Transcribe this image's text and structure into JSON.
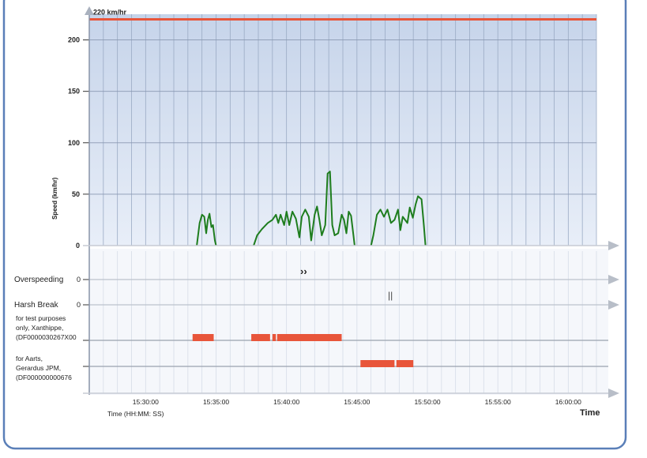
{
  "chart_data": [
    {
      "type": "line",
      "ylabel": "Speed (km/hr)",
      "y_ticks": [
        0,
        50,
        100,
        150,
        200
      ],
      "ylim": [
        0,
        225
      ],
      "xlim": [
        "15:26:00",
        "15:62:00"
      ],
      "grid": true,
      "threshold": {
        "value": 220,
        "label": "220 km/hr",
        "color": "#e8553a"
      },
      "series": [
        {
          "color": "#1e7d1e",
          "segments": [
            [
              [
                "15:33:38",
                0
              ],
              [
                "15:33:50",
                22
              ],
              [
                "15:34:00",
                30
              ],
              [
                "15:34:10",
                28
              ],
              [
                "15:34:18",
                12
              ],
              [
                "15:34:25",
                25
              ],
              [
                "15:34:32",
                31
              ],
              [
                "15:34:40",
                18
              ],
              [
                "15:34:47",
                20
              ],
              [
                "15:34:55",
                5
              ],
              [
                "15:35:00",
                0
              ]
            ],
            [
              [
                "15:37:40",
                0
              ],
              [
                "15:37:55",
                10
              ],
              [
                "15:38:15",
                16
              ],
              [
                "15:38:40",
                22
              ],
              [
                "15:39:00",
                25
              ],
              [
                "15:39:15",
                30
              ],
              [
                "15:39:25",
                22
              ],
              [
                "15:39:35",
                30
              ],
              [
                "15:39:50",
                20
              ],
              [
                "15:40:00",
                33
              ],
              [
                "15:40:12",
                20
              ],
              [
                "15:40:25",
                33
              ],
              [
                "15:40:40",
                26
              ],
              [
                "15:40:55",
                8
              ],
              [
                "15:41:05",
                28
              ],
              [
                "15:41:20",
                35
              ],
              [
                "15:41:35",
                28
              ],
              [
                "15:41:45",
                5
              ],
              [
                "15:42:00",
                30
              ],
              [
                "15:42:10",
                38
              ],
              [
                "15:42:20",
                25
              ],
              [
                "15:42:30",
                10
              ],
              [
                "15:42:38",
                15
              ],
              [
                "15:42:45",
                20
              ],
              [
                "15:42:55",
                70
              ],
              [
                "15:43:05",
                72
              ],
              [
                "15:43:15",
                20
              ],
              [
                "15:43:25",
                10
              ],
              [
                "15:43:40",
                12
              ],
              [
                "15:43:55",
                30
              ],
              [
                "15:44:05",
                25
              ],
              [
                "15:44:15",
                12
              ],
              [
                "15:44:25",
                33
              ],
              [
                "15:44:35",
                29
              ],
              [
                "15:44:45",
                10
              ],
              [
                "15:44:50",
                0
              ]
            ],
            [
              [
                "15:46:00",
                0
              ],
              [
                "15:46:10",
                10
              ],
              [
                "15:46:25",
                30
              ],
              [
                "15:46:40",
                35
              ],
              [
                "15:46:55",
                28
              ],
              [
                "15:47:10",
                35
              ],
              [
                "15:47:25",
                22
              ],
              [
                "15:47:40",
                25
              ],
              [
                "15:47:55",
                35
              ],
              [
                "15:48:05",
                15
              ],
              [
                "15:48:15",
                28
              ],
              [
                "15:48:35",
                22
              ],
              [
                "15:48:45",
                37
              ],
              [
                "15:48:58",
                27
              ],
              [
                "15:49:10",
                40
              ],
              [
                "15:49:20",
                48
              ],
              [
                "15:49:35",
                45
              ],
              [
                "15:49:45",
                20
              ],
              [
                "15:49:52",
                0
              ]
            ]
          ]
        }
      ]
    },
    {
      "type": "event-timeline",
      "rows": [
        {
          "label": "Overspeeding",
          "value": "0",
          "marker": "››"
        },
        {
          "label": "Harsh Break",
          "value": "0",
          "marker": "||"
        }
      ]
    },
    {
      "type": "gantt",
      "xlabel": "Time (HH:MM: SS)",
      "x_ticks": [
        "15:30:00",
        "15:35:00",
        "15:40:00",
        "15:45:00",
        "15:50:00",
        "15:55:00",
        "15:60:00"
      ],
      "x_tick_labels": [
        "15:30:00",
        "15:35:00",
        "15:40:00",
        "15:45:00",
        "15:50:00",
        "15:55:00",
        "16:00:00"
      ],
      "corner_label": "Time",
      "bar_color": "#e8553a",
      "rows": [
        {
          "label_lines": [
            "for test purposes",
            "only, Xanthippe,",
            "(DF0000030267X00"
          ],
          "bars": [
            [
              "15:33:20",
              "15:34:50"
            ],
            [
              "15:37:30",
              "15:38:50"
            ],
            [
              "15:39:00",
              "15:39:15"
            ],
            [
              "15:39:20",
              "15:43:55"
            ]
          ]
        },
        {
          "label_lines": [
            "for Aarts,",
            "Gerardus JPM,",
            "(DF000000000676"
          ],
          "bars": [
            [
              "15:45:15",
              "15:47:40"
            ],
            [
              "15:47:48",
              "15:49:00"
            ]
          ]
        }
      ]
    }
  ]
}
